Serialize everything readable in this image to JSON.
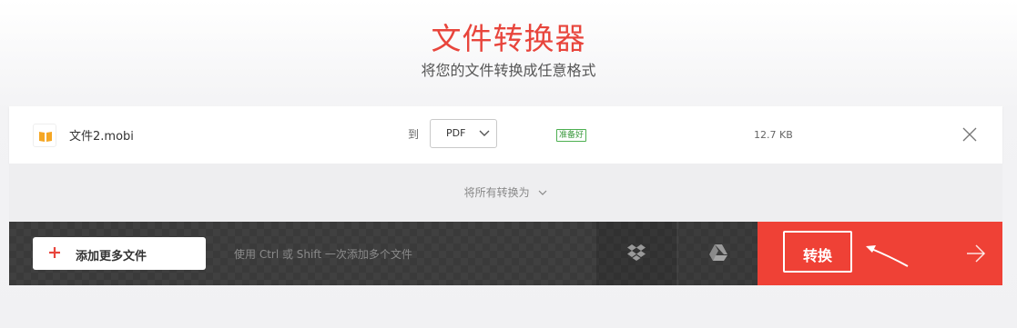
{
  "header": {
    "title": "文件转换器",
    "subtitle": "将您的文件转换成任意格式"
  },
  "file": {
    "icon": "book-icon",
    "name": "文件2.mobi",
    "to_label": "到",
    "format": "PDF",
    "status": "准备好",
    "size": "12.7 KB"
  },
  "convert_all": {
    "label": "将所有转换为"
  },
  "bottom_bar": {
    "add_files_label": "添加更多文件",
    "hint": "使用 Ctrl 或 Shift 一次添加多个文件",
    "convert_label": "转换"
  },
  "colors": {
    "accent": "#ef4136",
    "title": "#e8453c",
    "status": "#4caf50",
    "bar": "#3a3a3a"
  }
}
